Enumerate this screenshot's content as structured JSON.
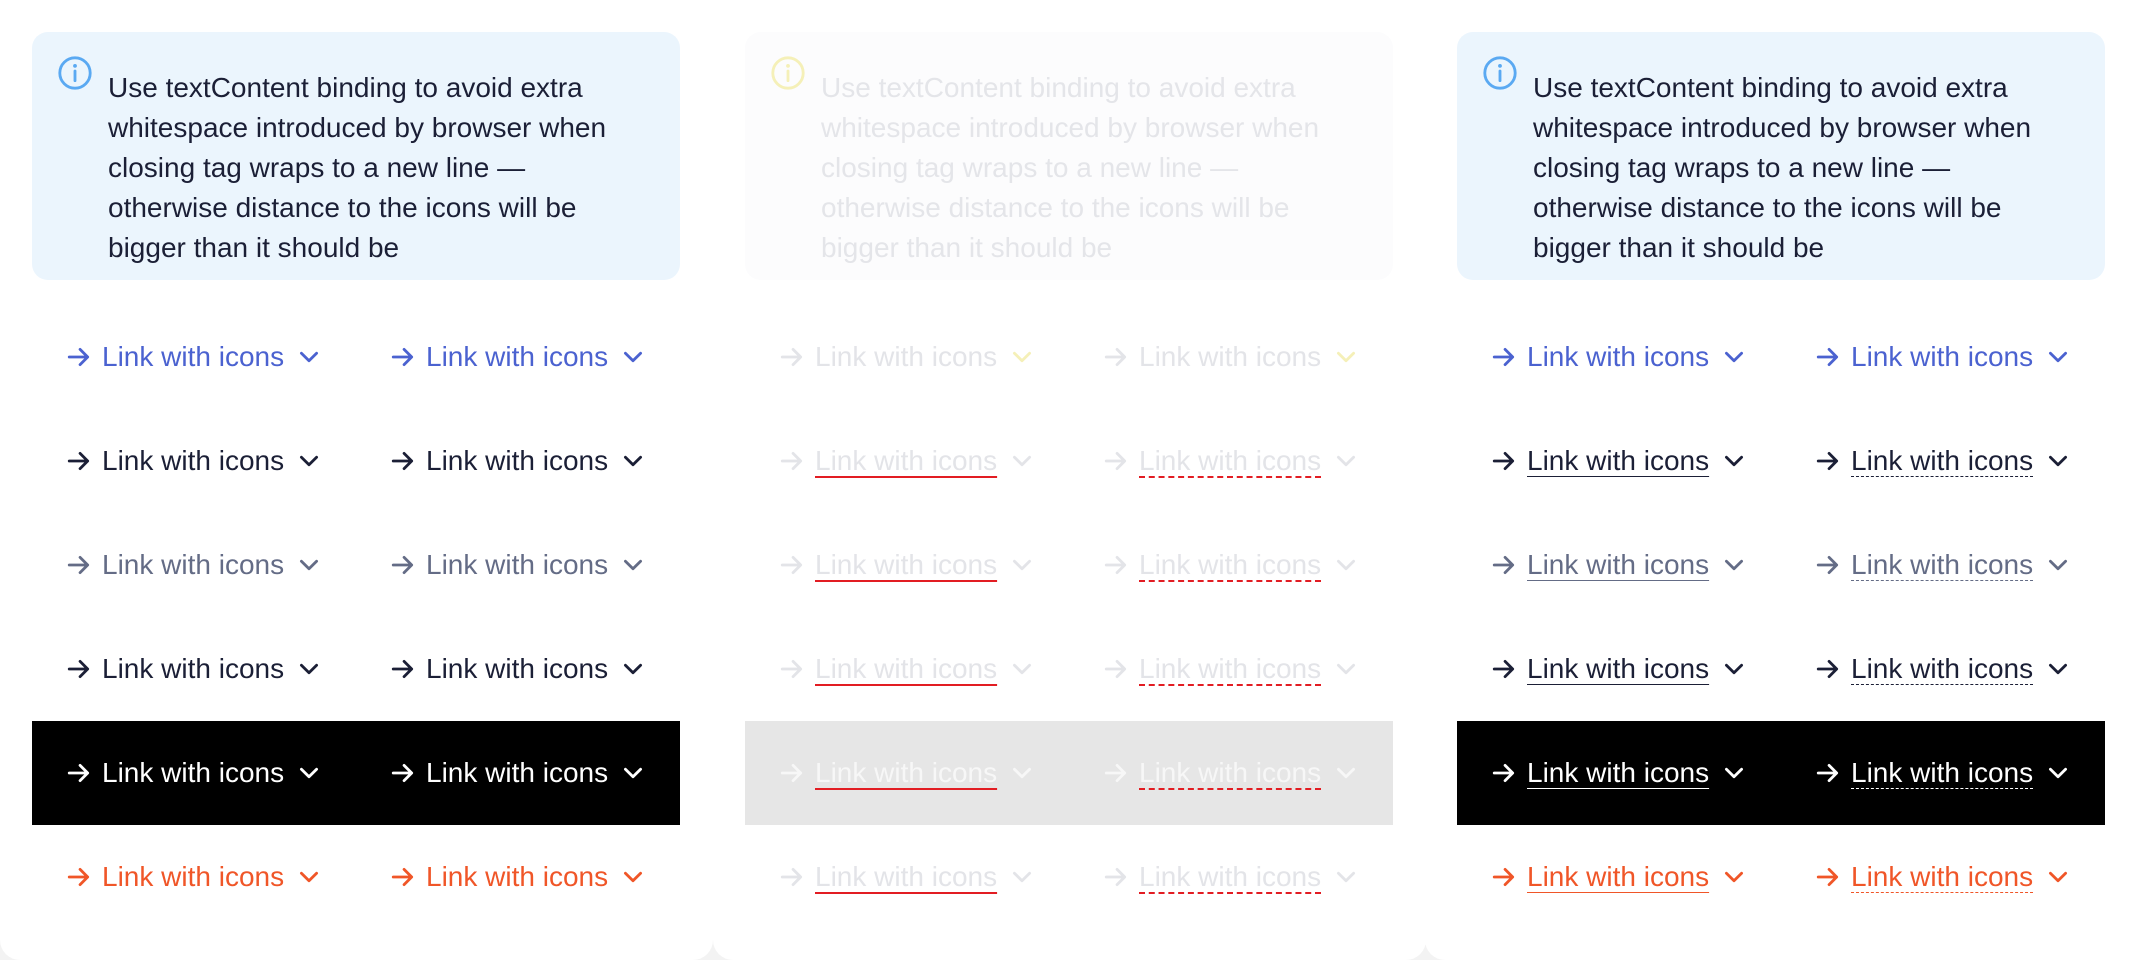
{
  "info_text": "Use textContent binding to avoid extra whitespace introduced by browser when closing tag wraps to a new line — otherwise distance to the icons will be bigger than it should be",
  "link_label": "Link with icons",
  "icons": {
    "info": "info-circle-icon",
    "leading": "arrow-right-icon",
    "trailing": "chevron-down-icon"
  },
  "colors": {
    "info_bg": "#ebf5fd",
    "info_icon": "#5aa9f2",
    "disabled_info_icon": "#f5f0b8",
    "blue": "#4b62d0",
    "dark": "#1b1f36",
    "gray": "#646c86",
    "white": "#ffffff",
    "orange": "#f05628",
    "disabled_text": "#e3e4e8",
    "error_underline": "#e21d23",
    "inverse_bg": "#000000",
    "disabled_inverse_bg": "#e6e6e6"
  }
}
